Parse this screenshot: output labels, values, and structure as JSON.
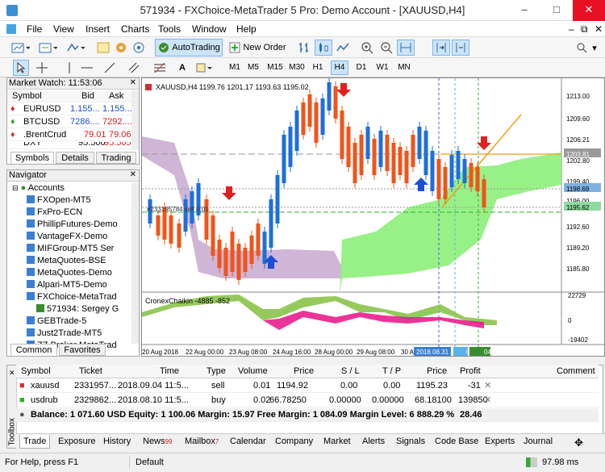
{
  "title": "571934 - FXChoice-MetaTrader 5 Pro: Demo Account - [XAUUSD,H4]",
  "menu": [
    "File",
    "View",
    "Insert",
    "Charts",
    "Tools",
    "Window",
    "Help"
  ],
  "toolbar": {
    "autotrading": "AutoTrading",
    "new_order": "New Order"
  },
  "timeframes": [
    "M1",
    "M5",
    "M15",
    "M30",
    "H1",
    "H4",
    "D1",
    "W1",
    "MN"
  ],
  "active_timeframe": "H4",
  "market_watch": {
    "title": "Market Watch: 11:53:06",
    "col_symbol": "Symbol",
    "col_bid": "Bid",
    "col_ask": "Ask",
    "rows": [
      {
        "symbol": "EURUSD",
        "bid": "1.155...",
        "ask": "1.155..."
      },
      {
        "symbol": "BTCUSD",
        "bid": "7286....",
        "ask": "7292...."
      },
      {
        "symbol": ".BrentCrud",
        "bid": "79.01",
        "ask": "79.06"
      },
      {
        "symbol": "DXY",
        "bid": "95.500",
        "ask": "95.505"
      }
    ],
    "tabs": [
      "Symbols",
      "Details",
      "Trading"
    ]
  },
  "navigator": {
    "title": "Navigator",
    "accounts": "Accounts",
    "items": [
      "FXOpen-MT5",
      "FxPro-ECN",
      "PhillipFutures-Demo",
      "VantageFX-Demo",
      "MIFGroup-MT5 Ser",
      "MetaQuotes-BSE",
      "MetaQuotes-Demo",
      "Alpari-MT5-Demo",
      "FXChoice-MetaTrad",
      "571934: Sergey G",
      "GEBTrade-5",
      "Just2Trade-MT5",
      "ZZ.Broker MetaTrad"
    ],
    "tabs": [
      "Common",
      "Favorites"
    ]
  },
  "chart": {
    "header": "XAUUSD,H4  1199.76 1201.17 1193.63 1195.02",
    "order_label": "#233195784 sell 0.01",
    "indicator": "CronexChaikin -4885 -852",
    "price_labels": [
      "1213.00",
      "1209.60",
      "1206.21",
      "1203.81",
      "1202.80",
      "1199.40",
      "1198.69",
      "1196.00",
      "1195.62",
      "1192.60",
      "1189.20",
      "1185.80"
    ],
    "ind_labels": [
      "22729",
      "0",
      "-19402"
    ],
    "time_labels": [
      "20 Aug 2018",
      "22 Aug 00:00",
      "23 Aug 08:00",
      "24 Aug 16:00",
      "28 Aug 00:00",
      "29 Aug 08:00",
      "30 A",
      "2018.08.31 20:00",
      "08:00",
      "04:00"
    ]
  },
  "trade": {
    "headers": [
      "Symbol",
      "Ticket",
      "Time",
      "Type",
      "Volume",
      "Price",
      "S / L",
      "T / P",
      "Price",
      "Profit",
      "Comment"
    ],
    "rows": [
      [
        "xauusd",
        "2331957...",
        "2018.09.04 11:5...",
        "sell",
        "0.01",
        "1194.92",
        "0.00",
        "0.00",
        "1195.23",
        "-31",
        ""
      ],
      [
        "usdrub",
        "2329862...",
        "2018.08.10 11:5...",
        "buy",
        "0.02",
        "66.78250",
        "0.00000",
        "0.00000",
        "68.18100",
        "139850",
        ""
      ]
    ],
    "balance": "Balance: 1 071.60 USD  Equity: 1 100.06  Margin: 15.97  Free Margin: 1 084.09  Margin Level: 6 888.29 %",
    "total": "28.46"
  },
  "bottom_tabs": [
    "Trade",
    "Exposure",
    "History",
    "News",
    "Mailbox",
    "Calendar",
    "Company",
    "Market",
    "Alerts",
    "Signals",
    "Code Base",
    "Experts",
    "Journal"
  ],
  "news_badge": "99",
  "mailbox_badge": "7",
  "toolbox": "Toolbox",
  "status": {
    "help": "For Help, press F1",
    "profile": "Default",
    "traffic": "97.98 ms"
  }
}
